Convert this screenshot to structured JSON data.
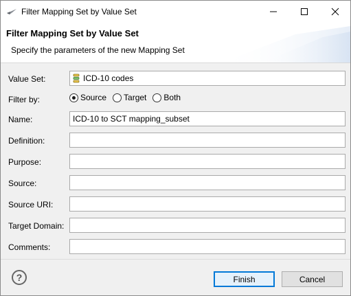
{
  "window": {
    "title": "Filter Mapping Set by Value Set"
  },
  "banner": {
    "title": "Filter Mapping Set by Value Set",
    "description": "Specify the parameters of the new Mapping Set"
  },
  "form": {
    "value_set": {
      "label": "Value Set:",
      "value": "ICD-10 codes",
      "icon": "database-icon"
    },
    "filter_by": {
      "label": "Filter by:",
      "options": [
        {
          "label": "Source",
          "selected": true
        },
        {
          "label": "Target",
          "selected": false
        },
        {
          "label": "Both",
          "selected": false
        }
      ]
    },
    "name": {
      "label": "Name:",
      "value": "ICD-10 to SCT mapping_subset"
    },
    "definition": {
      "label": "Definition:",
      "value": ""
    },
    "purpose": {
      "label": "Purpose:",
      "value": ""
    },
    "source": {
      "label": "Source:",
      "value": ""
    },
    "source_uri": {
      "label": "Source URI:",
      "value": ""
    },
    "target_domain": {
      "label": "Target Domain:",
      "value": ""
    },
    "comments": {
      "label": "Comments:",
      "value": ""
    }
  },
  "footer": {
    "help_icon": "help-icon",
    "finish_label": "Finish",
    "cancel_label": "Cancel"
  },
  "colors": {
    "finish_border": "#0078d7",
    "finish_bg": "#e5f1fb",
    "dialog_bg": "#f0f0f0",
    "banner_bg": "#ffffff"
  }
}
